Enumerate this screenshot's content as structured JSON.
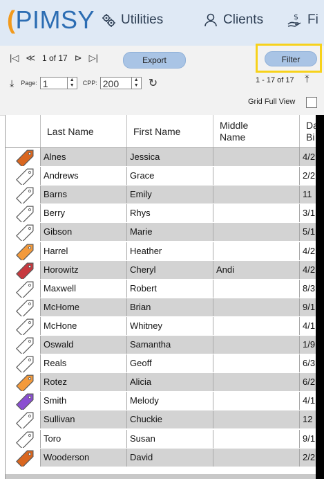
{
  "app": {
    "logo_text": "PIMSY",
    "logo_letter_color": "#f29a1d",
    "brand_color": "#2c6db3"
  },
  "nav": [
    {
      "label": "Utilities",
      "icon": "gears-icon"
    },
    {
      "label": "Clients",
      "icon": "person-icon"
    },
    {
      "label": "Fi",
      "icon": "money-hand-icon"
    }
  ],
  "toolbar": {
    "first_page_icon": "first-page-icon",
    "prev_page_icon": "prev-page-icon",
    "page_indicator": "1 of 17",
    "next_page_icon": "next-page-icon",
    "last_page_icon": "last-page-icon",
    "export_label": "Export",
    "filter_label": "Filter",
    "download_icon": "download-icon",
    "page_label": "Page:",
    "page_value": "1",
    "cpp_label": "CPP:",
    "cpp_value": "200",
    "refresh_icon": "refresh-icon",
    "range_text": "1 - 17 of 17",
    "scroll_top_icon": "scroll-top-icon",
    "grid_full_view_label": "Grid Full View"
  },
  "grid": {
    "columns": [
      "Last Name",
      "First Name",
      "Middle Name",
      "Da Bi"
    ],
    "rows": [
      {
        "last": "Alnes",
        "first": "Jessica",
        "middle": "",
        "dob": "4/2",
        "tag_color": "#d9661f",
        "shaded": true
      },
      {
        "last": "Andrews",
        "first": "Grace",
        "middle": "",
        "dob": "2/2",
        "tag_color": "#ffffff",
        "shaded": false
      },
      {
        "last": "Barns",
        "first": "Emily",
        "middle": "",
        "dob": "11",
        "tag_color": "#ffffff",
        "shaded": true
      },
      {
        "last": "Berry",
        "first": "Rhys",
        "middle": "",
        "dob": "3/1",
        "tag_color": "#ffffff",
        "shaded": false
      },
      {
        "last": "Gibson",
        "first": "Marie",
        "middle": "",
        "dob": "5/1",
        "tag_color": "#ffffff",
        "shaded": true
      },
      {
        "last": "Harrel",
        "first": "Heather",
        "middle": "",
        "dob": "4/2",
        "tag_color": "#f39a3c",
        "shaded": false
      },
      {
        "last": "Horowitz",
        "first": "Cheryl",
        "middle": "Andi",
        "dob": "4/2",
        "tag_color": "#c7393f",
        "shaded": true
      },
      {
        "last": "Maxwell",
        "first": "Robert",
        "middle": "",
        "dob": "8/3",
        "tag_color": "#ffffff",
        "shaded": false
      },
      {
        "last": "McHome",
        "first": "Brian",
        "middle": "",
        "dob": "9/1",
        "tag_color": "#ffffff",
        "shaded": true
      },
      {
        "last": "McHone",
        "first": "Whitney",
        "middle": "",
        "dob": "4/1",
        "tag_color": "#ffffff",
        "shaded": false
      },
      {
        "last": "Oswald",
        "first": "Samantha",
        "middle": "",
        "dob": "1/9",
        "tag_color": "#ffffff",
        "shaded": true
      },
      {
        "last": "Reals",
        "first": "Geoff",
        "middle": "",
        "dob": "6/3",
        "tag_color": "#ffffff",
        "shaded": false
      },
      {
        "last": "Rotez",
        "first": "Alicia",
        "middle": "",
        "dob": "6/2",
        "tag_color": "#f39a3c",
        "shaded": true
      },
      {
        "last": "Smith",
        "first": "Melody",
        "middle": "",
        "dob": "4/1",
        "tag_color": "#8a4fd1",
        "shaded": false
      },
      {
        "last": "Sullivan",
        "first": "Chuckie",
        "middle": "",
        "dob": "12",
        "tag_color": "#ffffff",
        "shaded": true
      },
      {
        "last": "Toro",
        "first": "Susan",
        "middle": "",
        "dob": "9/1",
        "tag_color": "#ffffff",
        "shaded": false
      },
      {
        "last": "Wooderson",
        "first": "David",
        "middle": "",
        "dob": "2/2",
        "tag_color": "#d9661f",
        "shaded": true
      }
    ]
  },
  "colors": {
    "highlight_border": "#f7d21b",
    "button_fill": "#a9c4e5"
  }
}
